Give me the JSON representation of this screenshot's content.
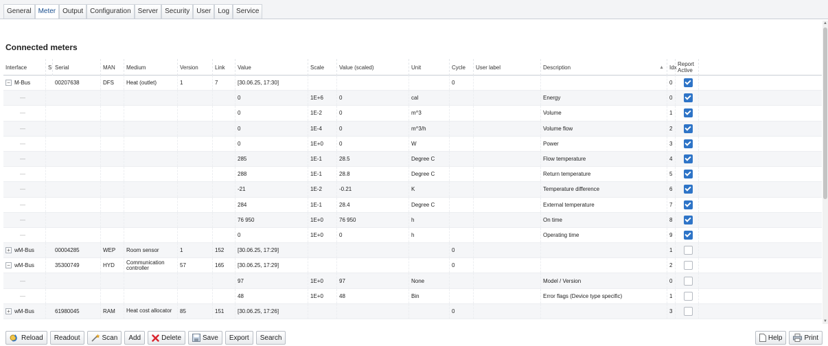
{
  "tabs": [
    "General",
    "Meter",
    "Output",
    "Configuration",
    "Server",
    "Security",
    "User",
    "Log",
    "Service"
  ],
  "active_tab": "Meter",
  "page_title": "Connected meters",
  "columns": {
    "interface": "Interface",
    "s": "S",
    "serial": "Serial",
    "man": "MAN",
    "medium": "Medium",
    "version": "Version",
    "link": "Link",
    "value": "Value",
    "scale": "Scale",
    "value_scaled": "Value (scaled)",
    "unit": "Unit",
    "cycle": "Cycle",
    "user_label": "User label",
    "description": "Description",
    "idx": "Idx",
    "report_line1": "Report",
    "report_line2": "Active"
  },
  "description_sort": "▲",
  "rows": [
    {
      "type": "meter",
      "expander": "−",
      "interface": "M-Bus",
      "serial": "00207638",
      "man": "DFS",
      "medium": "Heat (outlet)",
      "version": "1",
      "link": "7",
      "value": "[30.06.25, 17:30]",
      "scale": "",
      "value_scaled": "",
      "unit": "",
      "cycle": "0",
      "description": "",
      "idx": "0",
      "report": true
    },
    {
      "type": "value",
      "interface": "—",
      "value": "0",
      "scale": "1E+6",
      "value_scaled": "0",
      "unit": "cal",
      "description": "Energy",
      "idx": "0",
      "report": true
    },
    {
      "type": "value",
      "interface": "—",
      "value": "0",
      "scale": "1E-2",
      "value_scaled": "0",
      "unit": "m^3",
      "description": "Volume",
      "idx": "1",
      "report": true
    },
    {
      "type": "value",
      "interface": "—",
      "value": "0",
      "scale": "1E-4",
      "value_scaled": "0",
      "unit": "m^3/h",
      "description": "Volume flow",
      "idx": "2",
      "report": true
    },
    {
      "type": "value",
      "interface": "—",
      "value": "0",
      "scale": "1E+0",
      "value_scaled": "0",
      "unit": "W",
      "description": "Power",
      "idx": "3",
      "report": true
    },
    {
      "type": "value",
      "interface": "—",
      "value": "285",
      "scale": "1E-1",
      "value_scaled": "28.5",
      "unit": "Degree C",
      "description": "Flow temperature",
      "idx": "4",
      "report": true
    },
    {
      "type": "value",
      "interface": "—",
      "value": "288",
      "scale": "1E-1",
      "value_scaled": "28.8",
      "unit": "Degree C",
      "description": "Return temperature",
      "idx": "5",
      "report": true
    },
    {
      "type": "value",
      "interface": "—",
      "value": "-21",
      "scale": "1E-2",
      "value_scaled": "-0.21",
      "unit": "K",
      "description": "Temperature difference",
      "idx": "6",
      "report": true
    },
    {
      "type": "value",
      "interface": "—",
      "value": "284",
      "scale": "1E-1",
      "value_scaled": "28.4",
      "unit": "Degree C",
      "description": "External temperature",
      "idx": "7",
      "report": true
    },
    {
      "type": "value",
      "interface": "—",
      "value": "76 950",
      "scale": "1E+0",
      "value_scaled": "76 950",
      "unit": "h",
      "description": "On time",
      "idx": "8",
      "report": true
    },
    {
      "type": "value",
      "interface": "—",
      "value": "0",
      "scale": "1E+0",
      "value_scaled": "0",
      "unit": "h",
      "description": "Operating time",
      "idx": "9",
      "report": true
    },
    {
      "type": "meter",
      "expander": "+",
      "interface": "wM-Bus",
      "serial": "00004285",
      "man": "WEP",
      "medium": "Room sensor",
      "version": "1",
      "link": "152",
      "value": "[30.06.25, 17:29]",
      "scale": "",
      "value_scaled": "",
      "unit": "",
      "cycle": "0",
      "description": "",
      "idx": "1",
      "report": false
    },
    {
      "type": "meter",
      "expander": "−",
      "interface": "wM-Bus",
      "serial": "35300749",
      "man": "HYD",
      "medium": "Communication controller",
      "version": "57",
      "link": "165",
      "value": "[30.06.25, 17:29]",
      "scale": "",
      "value_scaled": "",
      "unit": "",
      "cycle": "0",
      "description": "",
      "idx": "2",
      "report": false
    },
    {
      "type": "value",
      "interface": "—",
      "value": "97",
      "scale": "1E+0",
      "value_scaled": "97",
      "unit": "None",
      "description": "Model / Version",
      "idx": "0",
      "report": false
    },
    {
      "type": "value",
      "interface": "—",
      "value": "48",
      "scale": "1E+0",
      "value_scaled": "48",
      "unit": "Bin",
      "description": "Error flags (Device type specific)",
      "idx": "1",
      "report": false
    },
    {
      "type": "meter",
      "expander": "+",
      "interface": "wM-Bus",
      "serial": "61980045",
      "man": "RAM",
      "medium": "Heat cost allocator",
      "version": "85",
      "link": "151",
      "value": "[30.06.25, 17:26]",
      "scale": "",
      "value_scaled": "",
      "unit": "",
      "cycle": "0",
      "description": "",
      "idx": "3",
      "report": false
    }
  ],
  "toolbar": {
    "reload": "Reload",
    "readout": "Readout",
    "scan": "Scan",
    "add": "Add",
    "delete": "Delete",
    "save": "Save",
    "export": "Export",
    "search": "Search",
    "help": "Help",
    "print": "Print"
  },
  "colors": {
    "accent": "#2e74c7",
    "delete_icon": "#d9232d",
    "scan_icon": "#e0a020"
  }
}
